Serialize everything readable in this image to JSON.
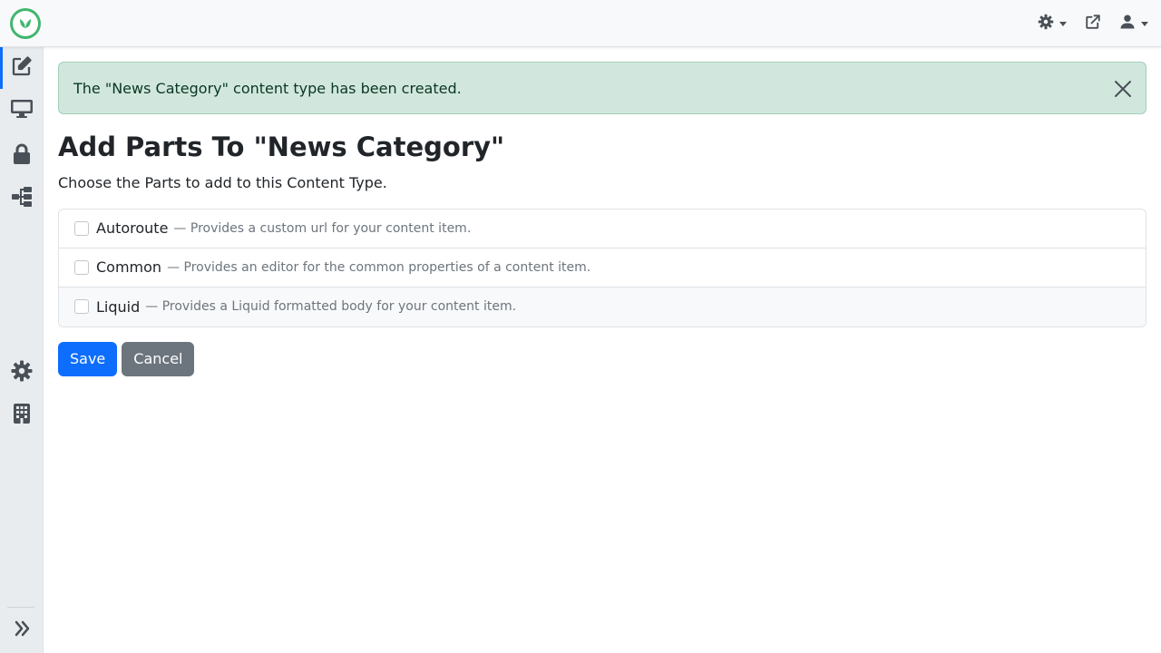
{
  "colors": {
    "accent": "#0d6efd",
    "success_bg": "#d1e7dd",
    "success_text": "#0a3622",
    "secondary": "#6c757d",
    "logo": "#41b670"
  },
  "header": {
    "logo_icon": "orchard-core-logo",
    "actions": [
      {
        "icon": "theme-toggle-icon",
        "has_dropdown": true
      },
      {
        "icon": "external-link-icon",
        "has_dropdown": false
      },
      {
        "icon": "user-icon",
        "has_dropdown": true
      }
    ]
  },
  "sidebar": {
    "items": [
      {
        "icon": "edit-icon",
        "active": true
      },
      {
        "icon": "desktop-icon",
        "active": false
      },
      {
        "icon": "lock-icon",
        "active": false
      },
      {
        "icon": "sitemap-icon",
        "active": false
      },
      {
        "icon": "gear-icon",
        "active": false
      },
      {
        "icon": "building-icon",
        "active": false
      }
    ],
    "toggle_icon": "double-chevron-right-icon"
  },
  "alert": {
    "message": "The \"News Category\" content type has been created.",
    "close_icon": "close-icon"
  },
  "page": {
    "title": "Add Parts To \"News Category\"",
    "intro": "Choose the Parts to add to this Content Type."
  },
  "parts": [
    {
      "name": "Autoroute",
      "description": "— Provides a custom url for your content item.",
      "checked": false
    },
    {
      "name": "Common",
      "description": "— Provides an editor for the common properties of a content item.",
      "checked": false
    },
    {
      "name": "Liquid",
      "description": "— Provides a Liquid formatted body for your content item.",
      "checked": false
    }
  ],
  "buttons": {
    "save_label": "Save",
    "cancel_label": "Cancel"
  }
}
